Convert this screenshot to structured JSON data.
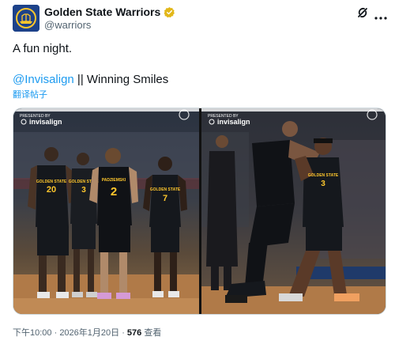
{
  "account": {
    "display_name": "Golden State Warriors",
    "handle": "@warriors"
  },
  "tweet": {
    "line1": "A fun night.",
    "mention": "@Invisalign",
    "line2_rest": " || Winning Smiles",
    "translate_label": "翻译帖子"
  },
  "media": {
    "left": {
      "sponsor_presented_by": "PRESENTED BY",
      "sponsor_name": "invisalign",
      "jersey_numbers": [
        "20",
        "3",
        "2",
        "7"
      ],
      "jersey_team": "GOLDEN STATE",
      "player_name_label": "PADZIEMSKI"
    },
    "right": {
      "sponsor_presented_by": "PRESENTED BY",
      "sponsor_name": "invisalign",
      "jersey_number": "3",
      "jersey_team": "GOLDEN STATE"
    }
  },
  "meta": {
    "time": "下午10:00",
    "separator1": " · ",
    "date": "2026年1月20日",
    "separator2": " · ",
    "views_count": "576",
    "views_label": " 查看"
  },
  "colors": {
    "link": "#1d9bf0",
    "warriors_blue": "#1d428a",
    "warriors_gold": "#ffc72c",
    "verified_gold": "#e2b719",
    "secondary_text": "#536471"
  }
}
